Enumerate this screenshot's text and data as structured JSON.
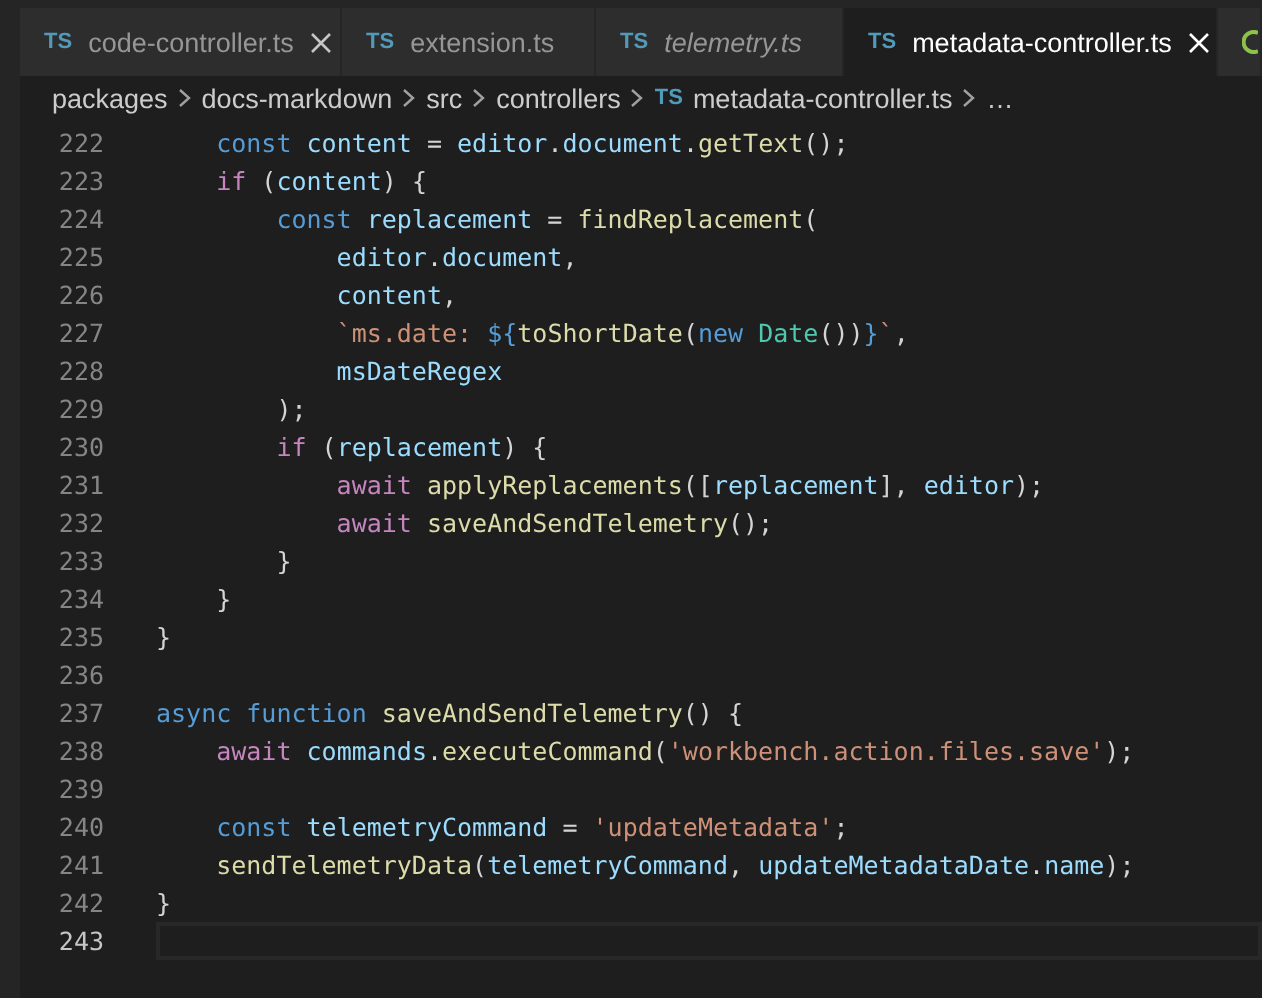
{
  "tabs": [
    {
      "icon": "TS",
      "label": "code-controller.ts",
      "selected": false,
      "preview": false,
      "show_close": true
    },
    {
      "icon": "TS",
      "label": "extension.ts",
      "selected": false,
      "preview": false,
      "show_close": false
    },
    {
      "icon": "TS",
      "label": "telemetry.ts",
      "selected": false,
      "preview": true,
      "show_close": false
    },
    {
      "icon": "TS",
      "label": "metadata-controller.ts",
      "selected": true,
      "preview": false,
      "show_close": true
    }
  ],
  "breadcrumb": [
    {
      "label": "packages"
    },
    {
      "label": "docs-markdown"
    },
    {
      "label": "src"
    },
    {
      "label": "controllers"
    },
    {
      "label": "metadata-controller.ts",
      "icon": "TS"
    },
    {
      "label": "…"
    }
  ],
  "lines": [
    {
      "number": "222",
      "current": false,
      "tokens": [
        {
          "kind": "keyword",
          "text": "    const "
        },
        {
          "kind": "variable",
          "text": "content"
        },
        {
          "kind": "punctuation",
          "text": " = "
        },
        {
          "kind": "variable",
          "text": "editor"
        },
        {
          "kind": "punctuation",
          "text": "."
        },
        {
          "kind": "variable",
          "text": "document"
        },
        {
          "kind": "punctuation",
          "text": "."
        },
        {
          "kind": "function",
          "text": "getText"
        },
        {
          "kind": "punctuation",
          "text": "();"
        }
      ]
    },
    {
      "number": "223",
      "current": false,
      "tokens": [
        {
          "kind": "control",
          "text": "    if"
        },
        {
          "kind": "punctuation",
          "text": " ("
        },
        {
          "kind": "variable",
          "text": "content"
        },
        {
          "kind": "punctuation",
          "text": ") {"
        }
      ]
    },
    {
      "number": "224",
      "current": false,
      "tokens": [
        {
          "kind": "keyword",
          "text": "        const "
        },
        {
          "kind": "variable",
          "text": "replacement"
        },
        {
          "kind": "punctuation",
          "text": " = "
        },
        {
          "kind": "function",
          "text": "findReplacement"
        },
        {
          "kind": "punctuation",
          "text": "("
        }
      ]
    },
    {
      "number": "225",
      "current": false,
      "tokens": [
        {
          "kind": "variable",
          "text": "            editor"
        },
        {
          "kind": "punctuation",
          "text": "."
        },
        {
          "kind": "variable",
          "text": "document"
        },
        {
          "kind": "punctuation",
          "text": ","
        }
      ]
    },
    {
      "number": "226",
      "current": false,
      "tokens": [
        {
          "kind": "variable",
          "text": "            content"
        },
        {
          "kind": "punctuation",
          "text": ","
        }
      ]
    },
    {
      "number": "227",
      "current": false,
      "tokens": [
        {
          "kind": "string",
          "text": "            `ms.date: "
        },
        {
          "kind": "keyword",
          "text": "${"
        },
        {
          "kind": "function",
          "text": "toShortDate"
        },
        {
          "kind": "punctuation",
          "text": "("
        },
        {
          "kind": "keyword",
          "text": "new "
        },
        {
          "kind": "type",
          "text": "Date"
        },
        {
          "kind": "punctuation",
          "text": "())"
        },
        {
          "kind": "keyword",
          "text": "}"
        },
        {
          "kind": "string",
          "text": "`"
        },
        {
          "kind": "punctuation",
          "text": ","
        }
      ]
    },
    {
      "number": "228",
      "current": false,
      "tokens": [
        {
          "kind": "variable",
          "text": "            msDateRegex"
        }
      ]
    },
    {
      "number": "229",
      "current": false,
      "tokens": [
        {
          "kind": "punctuation",
          "text": "        );"
        }
      ]
    },
    {
      "number": "230",
      "current": false,
      "tokens": [
        {
          "kind": "control",
          "text": "        if"
        },
        {
          "kind": "punctuation",
          "text": " ("
        },
        {
          "kind": "variable",
          "text": "replacement"
        },
        {
          "kind": "punctuation",
          "text": ") {"
        }
      ]
    },
    {
      "number": "231",
      "current": false,
      "tokens": [
        {
          "kind": "control",
          "text": "            await "
        },
        {
          "kind": "function",
          "text": "applyReplacements"
        },
        {
          "kind": "punctuation",
          "text": "(["
        },
        {
          "kind": "variable",
          "text": "replacement"
        },
        {
          "kind": "punctuation",
          "text": "], "
        },
        {
          "kind": "variable",
          "text": "editor"
        },
        {
          "kind": "punctuation",
          "text": ");"
        }
      ]
    },
    {
      "number": "232",
      "current": false,
      "tokens": [
        {
          "kind": "control",
          "text": "            await "
        },
        {
          "kind": "function",
          "text": "saveAndSendTelemetry"
        },
        {
          "kind": "punctuation",
          "text": "();"
        }
      ]
    },
    {
      "number": "233",
      "current": false,
      "tokens": [
        {
          "kind": "punctuation",
          "text": "        }"
        }
      ]
    },
    {
      "number": "234",
      "current": false,
      "tokens": [
        {
          "kind": "punctuation",
          "text": "    }"
        }
      ]
    },
    {
      "number": "235",
      "current": false,
      "tokens": [
        {
          "kind": "punctuation",
          "text": "}"
        }
      ]
    },
    {
      "number": "236",
      "current": false
    },
    {
      "number": "237",
      "current": false,
      "tokens": [
        {
          "kind": "keyword",
          "text": "async function "
        },
        {
          "kind": "function",
          "text": "saveAndSendTelemetry"
        },
        {
          "kind": "punctuation",
          "text": "() {"
        }
      ]
    },
    {
      "number": "238",
      "current": false,
      "tokens": [
        {
          "kind": "control",
          "text": "    await "
        },
        {
          "kind": "variable",
          "text": "commands"
        },
        {
          "kind": "punctuation",
          "text": "."
        },
        {
          "kind": "function",
          "text": "executeCommand"
        },
        {
          "kind": "punctuation",
          "text": "("
        },
        {
          "kind": "string",
          "text": "'workbench.action.files.save'"
        },
        {
          "kind": "punctuation",
          "text": ");"
        }
      ]
    },
    {
      "number": "239",
      "current": false
    },
    {
      "number": "240",
      "current": false,
      "tokens": [
        {
          "kind": "keyword",
          "text": "    const "
        },
        {
          "kind": "variable",
          "text": "telemetryCommand"
        },
        {
          "kind": "punctuation",
          "text": " = "
        },
        {
          "kind": "string",
          "text": "'updateMetadata'"
        },
        {
          "kind": "punctuation",
          "text": ";"
        }
      ]
    },
    {
      "number": "241",
      "current": false,
      "tokens": [
        {
          "kind": "function",
          "text": "    sendTelemetryData"
        },
        {
          "kind": "punctuation",
          "text": "("
        },
        {
          "kind": "variable",
          "text": "telemetryCommand"
        },
        {
          "kind": "punctuation",
          "text": ", "
        },
        {
          "kind": "variable",
          "text": "updateMetadataDate"
        },
        {
          "kind": "punctuation",
          "text": "."
        },
        {
          "kind": "variable",
          "text": "name"
        },
        {
          "kind": "punctuation",
          "text": ");"
        }
      ]
    },
    {
      "number": "242",
      "current": false,
      "tokens": [
        {
          "kind": "punctuation",
          "text": "}"
        }
      ]
    },
    {
      "number": "243",
      "current": true
    }
  ]
}
